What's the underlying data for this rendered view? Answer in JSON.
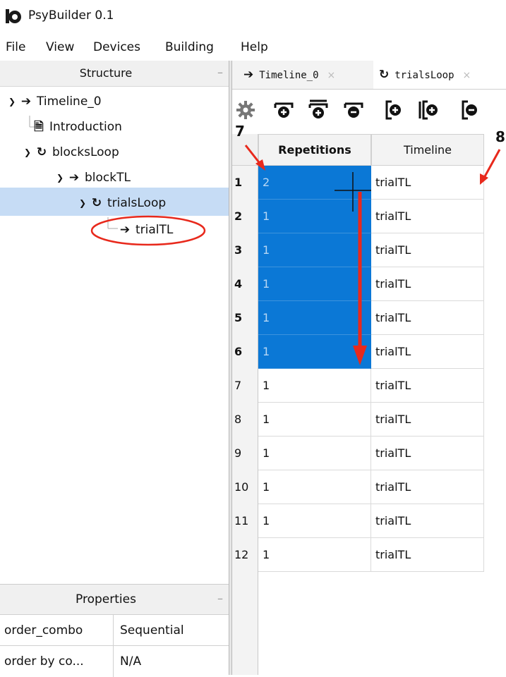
{
  "app": {
    "title": "PsyBuilder 0.1"
  },
  "menu": [
    "File",
    "View",
    "Devices",
    "Building",
    "Help"
  ],
  "structure": {
    "title": "Structure",
    "minimize": "–",
    "items": [
      {
        "label": "Timeline_0",
        "icon": "arrow-right-icon",
        "expanded": true
      },
      {
        "label": "Introduction",
        "icon": "document-icon"
      },
      {
        "label": "blocksLoop",
        "icon": "loop-icon",
        "expanded": true
      },
      {
        "label": "blockTL",
        "icon": "arrow-right-icon",
        "expanded": true
      },
      {
        "label": "trialsLoop",
        "icon": "loop-icon",
        "expanded": true,
        "selected": true
      },
      {
        "label": "trialTL",
        "icon": "arrow-right-icon",
        "highlighted": true
      }
    ]
  },
  "properties": {
    "title": "Properties",
    "minimize": "–",
    "rows": [
      {
        "key": "order_combo",
        "value": "Sequential"
      },
      {
        "key": "order by co...",
        "value": "N/A"
      }
    ]
  },
  "tabs": [
    {
      "label": "Timeline_0",
      "icon": "arrow-right-icon",
      "close": "×",
      "active": false
    },
    {
      "label": "trialsLoop",
      "icon": "loop-icon",
      "close": "×",
      "active": true
    }
  ],
  "toolbar": [
    "settings-icon",
    "add-row-icon",
    "insert-rows-icon",
    "remove-row-icon",
    "add-column-icon",
    "insert-column-icon",
    "remove-column-icon"
  ],
  "table": {
    "columns": [
      "Repetitions",
      "Timeline"
    ],
    "rows": [
      {
        "n": "1",
        "rep": "2",
        "tl": "trialTL",
        "selected": true
      },
      {
        "n": "2",
        "rep": "1",
        "tl": "trialTL",
        "selected": true
      },
      {
        "n": "3",
        "rep": "1",
        "tl": "trialTL",
        "selected": true
      },
      {
        "n": "4",
        "rep": "1",
        "tl": "trialTL",
        "selected": true
      },
      {
        "n": "5",
        "rep": "1",
        "tl": "trialTL",
        "selected": true
      },
      {
        "n": "6",
        "rep": "1",
        "tl": "trialTL",
        "selected": true
      },
      {
        "n": "7",
        "rep": "1",
        "tl": "trialTL"
      },
      {
        "n": "8",
        "rep": "1",
        "tl": "trialTL"
      },
      {
        "n": "9",
        "rep": "1",
        "tl": "trialTL"
      },
      {
        "n": "10",
        "rep": "1",
        "tl": "trialTL"
      },
      {
        "n": "11",
        "rep": "1",
        "tl": "trialTL"
      },
      {
        "n": "12",
        "rep": "1",
        "tl": "trialTL"
      }
    ]
  },
  "annotations": {
    "label_7": "7",
    "label_8": "8",
    "color": "#e8291c"
  },
  "colors": {
    "selection": "#0b78d6",
    "tree_selected": "#c6dcf5"
  }
}
